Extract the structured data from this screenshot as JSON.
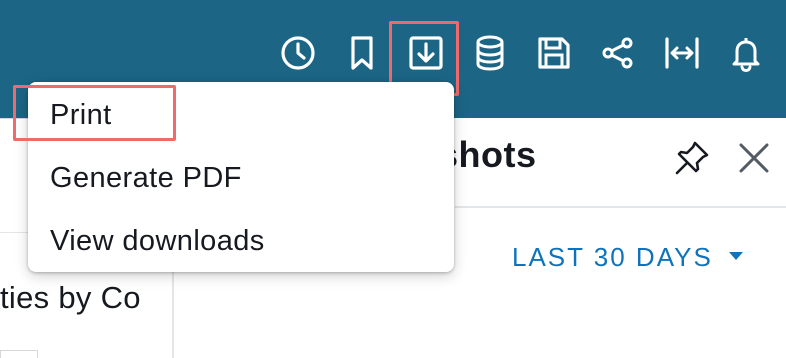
{
  "toolbar": {
    "icons": [
      "clock-icon",
      "bookmark-icon",
      "download-icon",
      "database-icon",
      "save-icon",
      "share-icon",
      "fit-width-icon",
      "bell-icon"
    ],
    "colors": {
      "bar": "#1c6585",
      "icon": "#ffffff",
      "highlight": "#ef6b6b"
    }
  },
  "download_menu": {
    "items": [
      {
        "label": "Print"
      },
      {
        "label": "Generate PDF"
      },
      {
        "label": "View downloads"
      }
    ]
  },
  "side_panel": {
    "title_fragment": "shots",
    "date_range": "LAST 30 DAYS",
    "accent_color": "#0f73bb"
  },
  "visual": {
    "title_fragment": "ties by Co"
  }
}
